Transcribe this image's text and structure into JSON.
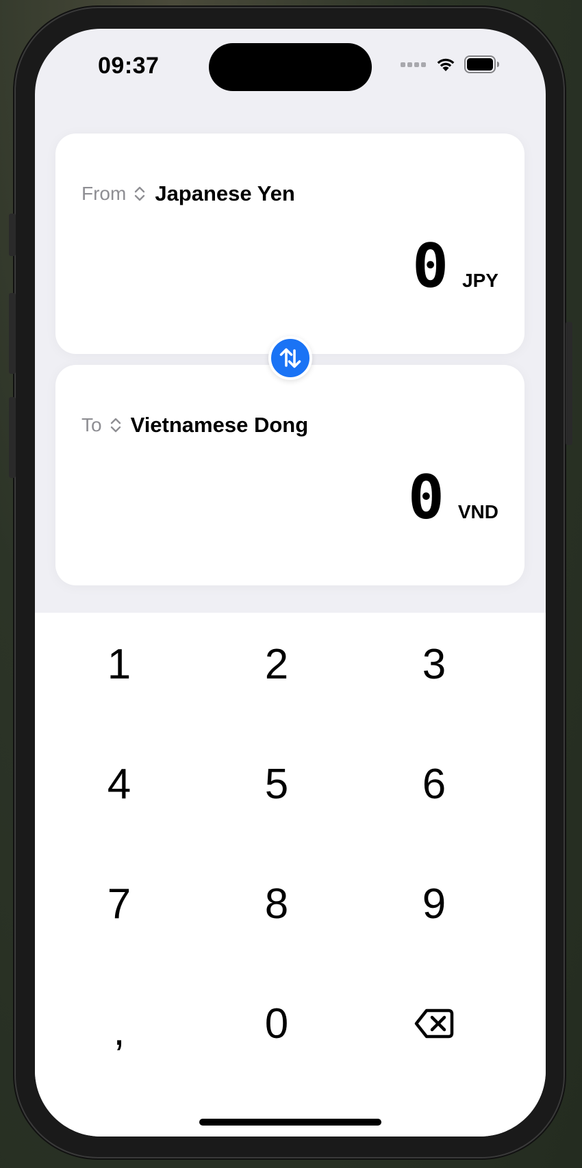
{
  "status_bar": {
    "time": "09:37"
  },
  "from_card": {
    "label": "From",
    "currency_name": "Japanese Yen",
    "amount": "0",
    "currency_code": "JPY"
  },
  "to_card": {
    "label": "To",
    "currency_name": "Vietnamese Dong",
    "amount": "0",
    "currency_code": "VND"
  },
  "swap_button": {
    "icon": "swap-vertical-icon",
    "color": "#1a73f5"
  },
  "keypad": {
    "keys": [
      "1",
      "2",
      "3",
      "4",
      "5",
      "6",
      "7",
      "8",
      "9",
      ",",
      "0"
    ],
    "delete_icon": "backspace-icon"
  },
  "colors": {
    "background": "#efeff4",
    "card": "#ffffff",
    "accent": "#1a73f5",
    "secondary_text": "#8e8e93"
  }
}
